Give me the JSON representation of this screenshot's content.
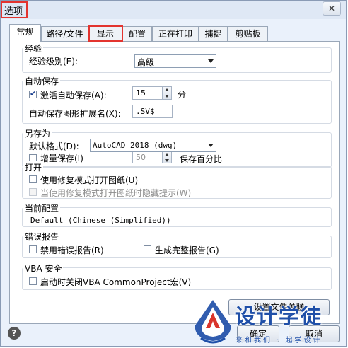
{
  "window": {
    "title": "选项",
    "close_symbol": "✕"
  },
  "tabs": [
    {
      "label": "常规"
    },
    {
      "label": "路径/文件"
    },
    {
      "label": "显示"
    },
    {
      "label": "配置"
    },
    {
      "label": "正在打印"
    },
    {
      "label": "捕捉"
    },
    {
      "label": "剪贴板"
    }
  ],
  "experience": {
    "title": "经验",
    "level_label": "经验级别(E):",
    "level_value": "高级"
  },
  "autosave": {
    "title": "自动保存",
    "enable_label": "激活自动保存(A):",
    "enable_checked": true,
    "interval_value": "15",
    "interval_unit": "分",
    "extension_label": "自动保存图形扩展名(X):",
    "extension_value": ".SV$"
  },
  "saveas": {
    "title": "另存为",
    "format_label": "默认格式(D):",
    "format_value": "AutoCAD 2018 (dwg)",
    "incremental_label": "增量保存(I)",
    "incremental_value": "50",
    "incremental_unit": "保存百分比"
  },
  "open": {
    "title": "打开",
    "repair_label": "使用修复模式打开图纸(U)",
    "hide_prompt_label": "当使用修复模式打开图纸时隐藏提示(W)"
  },
  "profile": {
    "title": "当前配置",
    "value": "Default (Chinese (Simplified))"
  },
  "error_report": {
    "title": "错误报告",
    "disable_label": "禁用错误报告(R)",
    "full_label": "生成完整报告(G)"
  },
  "vba": {
    "title": "VBA 安全",
    "close_label": "启动时关闭VBA CommonProject宏(V)"
  },
  "buttons": {
    "file_assoc": "设置文件关联",
    "ok": "确定",
    "cancel": "取消",
    "help": "?"
  },
  "watermark": {
    "brand": "设计学徒",
    "slogan": "来和我们 · 起学设计"
  },
  "colors": {
    "highlight": "#e3342f",
    "watermark": "#1f4fa8"
  }
}
